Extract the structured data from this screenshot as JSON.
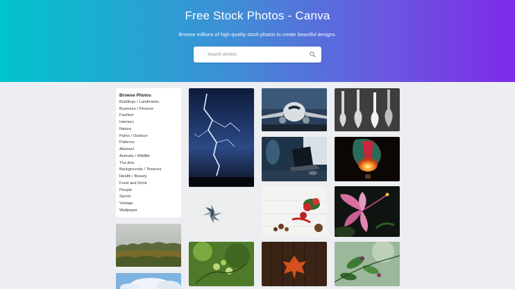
{
  "hero": {
    "title": "Free Stock Photos - Canva",
    "subtitle": "Browse millions of high-quality stock photos to create beautiful designs.",
    "search_placeholder": "Search photos",
    "gradient": [
      "#00c4cc",
      "#7d2ae8"
    ]
  },
  "sidebar": {
    "heading": "Browse Photos",
    "items": [
      "Buildings / Landmarks",
      "Business / Finance",
      "Fashion",
      "Interiors",
      "Nature",
      "Parks / Outdoor",
      "Patterns",
      "Abstract",
      "Animals / Wildlife",
      "The Arts",
      "Backgrounds / Textures",
      "Health / Beauty",
      "Food and Drink",
      "People",
      "Sports",
      "Vintage",
      "Wallpaper"
    ]
  },
  "photos": [
    "lightning-storm",
    "forest-treeline",
    "sky-clouds",
    "pinwheel",
    "green-plant",
    "airplane",
    "laptop-desk",
    "red-flowers-pinecones",
    "wood-autumn-leaf",
    "guitars",
    "hot-air-balloon",
    "pink-hibiscus",
    "green-leaves"
  ]
}
